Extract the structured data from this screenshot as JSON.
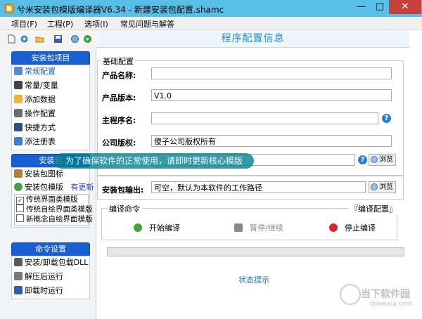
{
  "window": {
    "title": "兮米安装包模版编译器V6.34 - 新建安装包配置.shamc",
    "minimize_glyph": "—",
    "maximize_glyph": "□",
    "close_glyph": "✕"
  },
  "menu": {
    "items": [
      "项目(F)",
      "工程(P)",
      "选项(I)",
      "常见问题与解答"
    ]
  },
  "toolbar": {
    "icons": [
      "new-icon",
      "open-icon",
      "open-dropdown-icon",
      "save-icon",
      "build-icon",
      "run-icon"
    ]
  },
  "sidebar": {
    "project_header": "安装包项目",
    "project_items": [
      "常规配置",
      "常量/变量",
      "添加数据",
      "操作配置",
      "快捷方式",
      "添注册表"
    ],
    "skin_header": "安装包",
    "skin_items": [
      "安装包图标",
      "安装包模版"
    ],
    "update_link": "有更新",
    "templates": [
      {
        "label": "传统界面类模版",
        "checked": true
      },
      {
        "label": "传统自绘界面类模版",
        "checked": false
      },
      {
        "label": "新概念自绘界面模版",
        "checked": false
      }
    ],
    "command_header": "命令设置",
    "command_items": [
      "安装/卸载包载DLL",
      "解压后运行",
      "卸载时运行"
    ]
  },
  "main": {
    "title": "程序配置信息",
    "basic_group": "基础配置",
    "fields": {
      "product_name_label": "产品名称:",
      "product_name_value": "",
      "product_version_label": "产品版本:",
      "product_version_value": "V1.0",
      "main_program_label": "主程序名:",
      "main_program_value": "",
      "copyright_label": "公司版权:",
      "copyright_value": "傻子公司版权所有"
    },
    "browse_label": "浏览",
    "help_glyph": "?",
    "output_label": "安装包输出:",
    "output_value": "可空，默认为本软件的工作路径",
    "compile_group": "编译命令",
    "compile_config_label": "『编译配置』",
    "start_label": "开始编译",
    "pause_label": "暂停/继续",
    "stop_label": "停止编译",
    "progress": 0,
    "status_label": "状态提示"
  },
  "tooltip": "为了确保软件的正常使用，请即时更新核心模版",
  "watermark": {
    "brand": "当下软件园",
    "url": "downxia.com"
  },
  "colors": {
    "titlebar": "#58bfe7",
    "close": "#c7413a",
    "section_header": "#1a5fd1",
    "title_text": "#1e8ed8",
    "start": "#3ea43a",
    "pause": "#8a8a8a",
    "stop": "#d9262a"
  }
}
